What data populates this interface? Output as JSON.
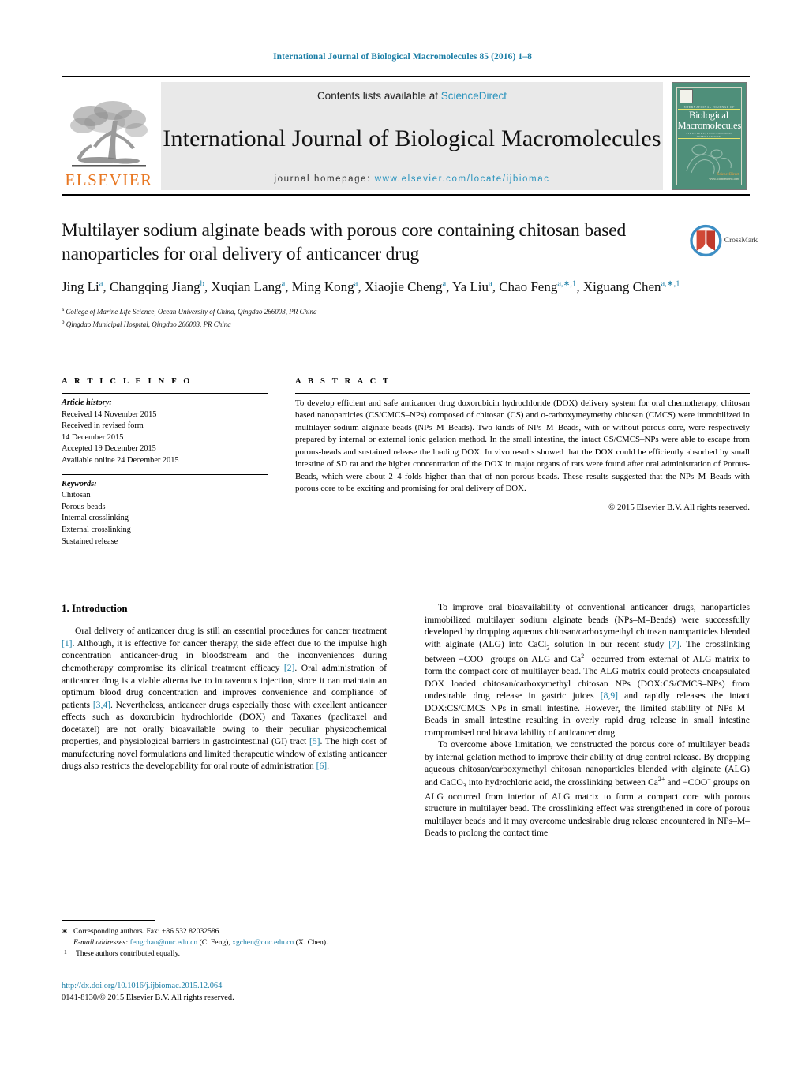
{
  "running_head": "International Journal of Biological Macromolecules 85 (2016) 1–8",
  "masthead": {
    "publisher": "ELSEVIER",
    "contents_prefix": "Contents lists available at ",
    "contents_link": "ScienceDirect",
    "journal_title": "International Journal of Biological Macromolecules",
    "homepage_prefix": "journal homepage: ",
    "homepage_url": "www.elsevier.com/locate/ijbiomac",
    "cover": {
      "kicker": "INTERNATIONAL JOURNAL OF",
      "title_line1": "Biological",
      "title_line2": "Macromolecules",
      "subtitle": "STRUCTURE, FUNCTION AND INTERACTIONS",
      "footer_brand": "ScienceDirect",
      "footer_note": "www.sciencedirect.com"
    },
    "link_color": "#2a93bd",
    "brand_color": "#e87722",
    "band_color": "#e9e9e9"
  },
  "crossmark": {
    "label": "CrossMark",
    "ring_color": "#3c8ec4",
    "book_color": "#c0392b"
  },
  "article": {
    "title": "Multilayer sodium alginate beads with porous core containing chitosan based nanoparticles for oral delivery of anticancer drug",
    "authors_html": "Jing Li<sup>a</sup>, Changqing Jiang<sup>b</sup>, Xuqian Lang<sup>a</sup>, Ming Kong<sup>a</sup>, Xiaojie Cheng<sup>a</sup>, Ya Liu<sup>a</sup>, Chao Feng<sup>a,∗,1</sup>, Xiguang Chen<sup>a,∗,1</sup>",
    "affiliations": [
      {
        "mark": "a",
        "text": "College of Marine Life Science, Ocean University of China, Qingdao 266003, PR China"
      },
      {
        "mark": "b",
        "text": "Qingdao Municipal Hospital, Qingdao 266003, PR China"
      }
    ]
  },
  "article_info": {
    "heading": "A R T I C L E    I N F O",
    "history_label": "Article history:",
    "history": [
      "Received 14 November 2015",
      "Received in revised form",
      "14 December 2015",
      "Accepted 19 December 2015",
      "Available online 24 December 2015"
    ],
    "keywords_label": "Keywords:",
    "keywords": [
      "Chitosan",
      "Porous-beads",
      "Internal crosslinking",
      "External crosslinking",
      "Sustained release"
    ]
  },
  "abstract": {
    "heading": "A B S T R A C T",
    "text_html": "To develop efficient and safe anticancer drug doxorubicin hydrochloride (DOX) delivery system for oral chemotherapy, chitosan based nanoparticles (CS/CMCS–NPs) composed of chitosan (CS) and o-carboxymeymethy chitosan (CMCS) were immobilized in multilayer sodium alginate beads (NPs–M–Beads). Two kinds of NPs–M–Beads, with or without porous core, were respectively prepared by internal or external ionic gelation method. In the small intestine, the intact CS/CMCS–NPs were able to escape from porous-beads and sustained release the loading DOX. In vivo results showed that the DOX could be efficiently absorbed by small intestine of SD rat and the higher concentration of the DOX in major organs of rats were found after oral administration of Porous-Beads, which were about 2–4 folds higher than that of non-porous-beads. These results suggested that the NPs–M–Beads with porous core to be exciting and promising for oral delivery of DOX.",
    "copyright": "© 2015 Elsevier B.V. All rights reserved."
  },
  "introduction": {
    "section_number_title": "1.  Introduction",
    "left_paragraphs_html": [
      "Oral delivery of anticancer drug is still an essential procedures for cancer treatment <span class=\"ref\">[1]</span>. Although, it is effective for cancer therapy, the side effect due to the impulse high concentration anticancer-drug in bloodstream and the inconveniences during chemotherapy compromise its clinical treatment efficacy <span class=\"ref\">[2]</span>. Oral administration of anticancer drug is a viable alternative to intravenous injection, since it can maintain an optimum blood drug concentration and improves convenience and compliance of patients <span class=\"ref\">[3,4]</span>. Nevertheless, anticancer drugs especially those with excellent anticancer effects such as doxorubicin hydrochloride (DOX) and Taxanes (paclitaxel and docetaxel) are not orally bioavailable owing to their peculiar physicochemical properties, and physiological barriers in gastrointestinal (GI) tract <span class=\"ref\">[5]</span>. The high cost of manufacturing novel formulations and limited therapeutic window of existing anticancer drugs also restricts the developability for oral route of administration <span class=\"ref\">[6]</span>."
    ],
    "right_paragraphs_html": [
      "To improve oral bioavailability of conventional anticancer drugs, nanoparticles immobilized multilayer sodium alginate beads (NPs–M–Beads) were successfully developed by dropping aqueous chitosan/carboxymethyl chitosan nanoparticles blended with alginate (ALG) into CaCl<span class=\"sb\">2</span> solution in our recent study <span class=\"ref\">[7]</span>. The crosslinking between −COO<span class=\"sup\">−</span> groups on ALG and Ca<span class=\"sup\">2+</span> occurred from external of ALG matrix to form the compact core of multilayer bead. The ALG matrix could protects encapsulated DOX loaded chitosan/carboxymethyl chitosan NPs (DOX:CS/CMCS–NPs) from undesirable drug release in gastric juices <span class=\"ref\">[8,9]</span> and rapidly releases the intact DOX:CS/CMCS–NPs in small intestine. However, the limited stability of NPs–M–Beads in small intestine resulting in overly rapid drug release in small intestine compromised oral bioavailability of anticancer drug.",
      "To overcome above limitation, we constructed the porous core of multilayer beads by internal gelation method to improve their ability of drug control release. By dropping aqueous chitosan/carboxymethyl chitosan nanoparticles blended with alginate (ALG) and CaCO<span class=\"sb\">3</span> into hydrochloric acid, the crosslinking between Ca<span class=\"sup\">2+</span> and −COO<span class=\"sup\">−</span> groups on ALG occurred from interior of ALG matrix to form a compact core with porous structure in multilayer bead. The crosslinking effect was strengthened in core of porous multilayer beads and it may overcome undesirable drug release encountered in NPs–M–Beads to prolong the contact time"
    ]
  },
  "footnotes": {
    "corresponding_mark": "∗",
    "corresponding_text": "Corresponding authors. Fax: +86 532 82032586.",
    "email_label": "E-mail addresses:",
    "email1": "fengchao@ouc.edu.cn",
    "email1_owner": "(C. Feng),",
    "email2": "xgchen@ouc.edu.cn",
    "email2_owner": "(X. Chen).",
    "equal_mark": "1",
    "equal_text": "These authors contributed equally."
  },
  "footer": {
    "doi_url": "http://dx.doi.org/10.1016/j.ijbiomac.2015.12.064",
    "issn_line": "0141-8130/© 2015 Elsevier B.V. All rights reserved."
  }
}
